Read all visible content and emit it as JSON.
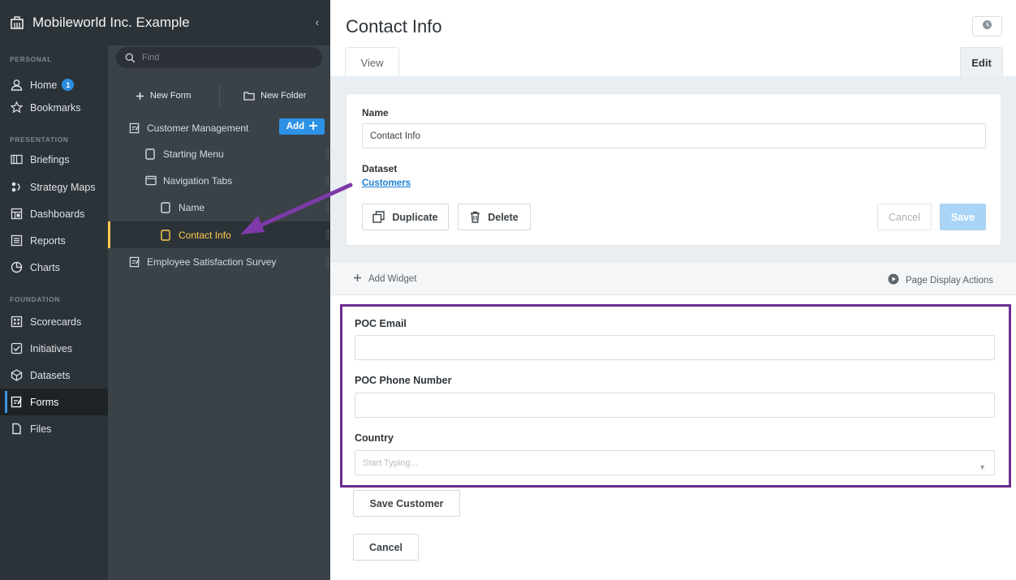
{
  "org": {
    "name": "Mobileworld Inc. Example",
    "collapse_icon": "chevron-left-icon"
  },
  "nav": {
    "sections": {
      "personal": "PERSONAL",
      "presentation": "PRESENTATION",
      "foundation": "FOUNDATION"
    },
    "items": [
      {
        "label": "Home",
        "icon": "user-icon",
        "badge": "1"
      },
      {
        "label": "Bookmarks",
        "icon": "star-icon"
      },
      {
        "label": "Briefings",
        "icon": "book-icon"
      },
      {
        "label": "Strategy Maps",
        "icon": "strategy-map-icon"
      },
      {
        "label": "Dashboards",
        "icon": "dashboard-icon"
      },
      {
        "label": "Reports",
        "icon": "report-icon"
      },
      {
        "label": "Charts",
        "icon": "pie-chart-icon"
      },
      {
        "label": "Scorecards",
        "icon": "scorecard-icon"
      },
      {
        "label": "Initiatives",
        "icon": "checkbox-icon"
      },
      {
        "label": "Datasets",
        "icon": "dataset-icon"
      },
      {
        "label": "Forms",
        "icon": "form-icon",
        "active": true
      },
      {
        "label": "Files",
        "icon": "file-icon"
      }
    ]
  },
  "tree": {
    "search_placeholder": "Find",
    "new_form": "New Form",
    "new_folder": "New Folder",
    "add_label": "Add",
    "items": [
      {
        "label": "Customer Management",
        "icon": "form-icon"
      },
      {
        "label": "Starting Menu",
        "icon": "page-icon"
      },
      {
        "label": "Navigation Tabs",
        "icon": "tabs-icon"
      },
      {
        "label": "Name",
        "icon": "page-icon"
      },
      {
        "label": "Contact Info",
        "icon": "page-icon",
        "selected": true
      },
      {
        "label": "Employee Satisfaction Survey",
        "icon": "form-icon"
      }
    ]
  },
  "main": {
    "title": "Contact Info",
    "tabs": {
      "view": "View",
      "edit": "Edit"
    },
    "name_label": "Name",
    "name_value": "Contact Info",
    "dataset_label": "Dataset",
    "dataset_link": "Customers",
    "duplicate": "Duplicate",
    "delete": "Delete",
    "cancel": "Cancel",
    "save": "Save",
    "add_widget": "Add Widget",
    "page_display_actions": "Page Display Actions"
  },
  "widgets": {
    "poc_email_label": "POC Email",
    "poc_email_value": "",
    "poc_phone_label": "POC Phone Number",
    "poc_phone_value": "",
    "country_label": "Country",
    "country_placeholder": "Start Typing...",
    "save_customer": "Save Customer",
    "cancel": "Cancel"
  },
  "colors": {
    "nav_bg": "#2c3338",
    "tree_bg": "#3a4248",
    "accent_blue": "#2d92e6",
    "selected_yellow": "#ffcc4d",
    "annotation_purple": "#6b2c91"
  }
}
